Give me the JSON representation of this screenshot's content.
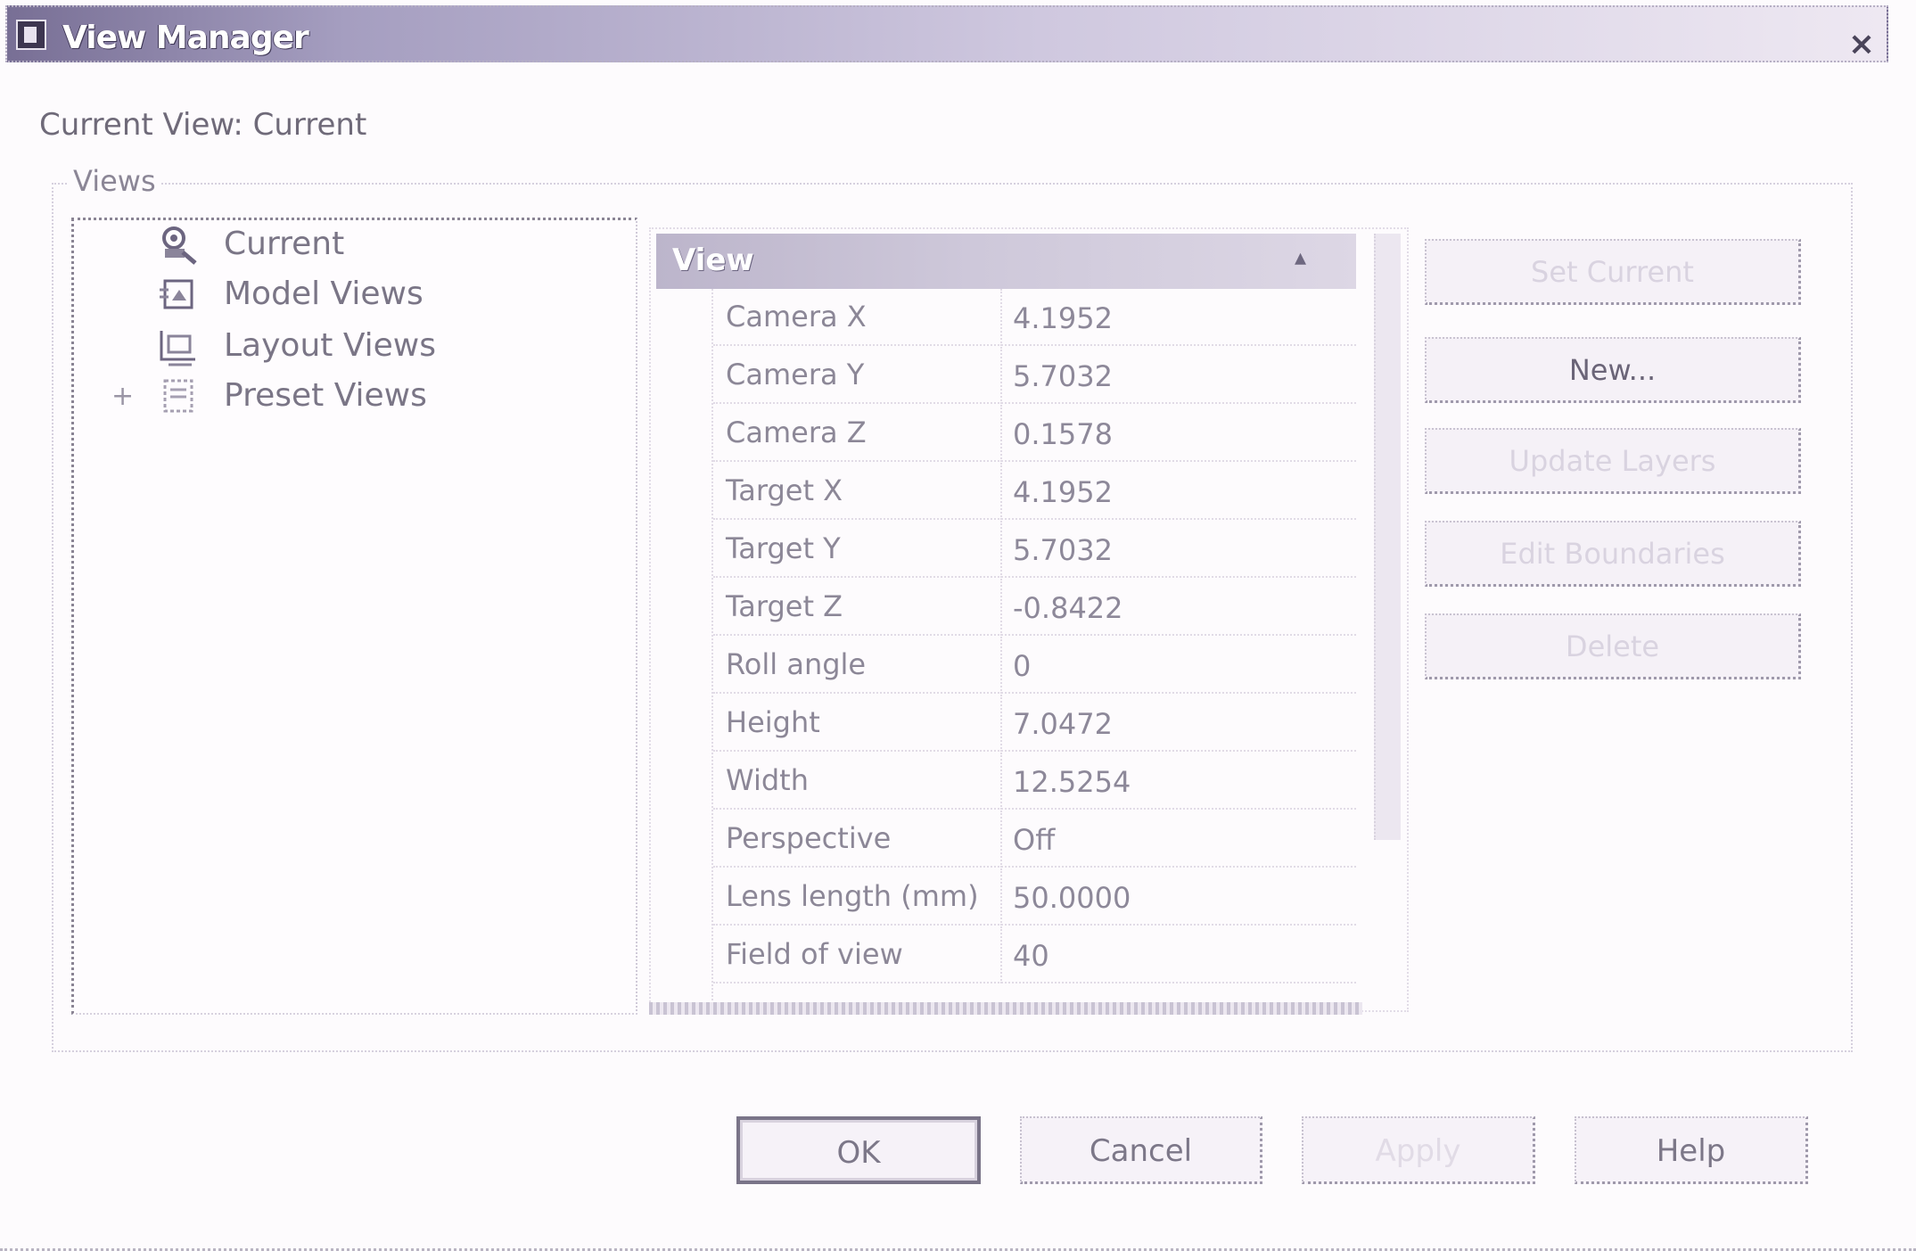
{
  "window": {
    "title": "View Manager",
    "close_glyph": "×"
  },
  "current_view": "Current View: Current",
  "views_group": {
    "label": "Views",
    "tree": [
      {
        "label": "Current",
        "icon": "camera-view-icon",
        "expander": ""
      },
      {
        "label": "Model Views",
        "icon": "model-views-icon",
        "expander": ""
      },
      {
        "label": "Layout Views",
        "icon": "layout-views-icon",
        "expander": ""
      },
      {
        "label": "Preset Views",
        "icon": "preset-views-icon",
        "expander": "+"
      }
    ]
  },
  "properties": {
    "category": "View",
    "collapse_glyph": "▴",
    "rows": [
      {
        "name": "Camera X",
        "value": "4.1952"
      },
      {
        "name": "Camera Y",
        "value": "5.7032"
      },
      {
        "name": "Camera Z",
        "value": "0.1578"
      },
      {
        "name": "Target X",
        "value": "4.1952"
      },
      {
        "name": "Target Y",
        "value": "5.7032"
      },
      {
        "name": "Target Z",
        "value": "-0.8422"
      },
      {
        "name": "Roll angle",
        "value": "0"
      },
      {
        "name": "Height",
        "value": "7.0472"
      },
      {
        "name": "Width",
        "value": "12.5254"
      },
      {
        "name": "Perspective",
        "value": "Off"
      },
      {
        "name": "Lens length (mm)",
        "value": "50.0000"
      },
      {
        "name": "Field of view",
        "value": "40"
      }
    ]
  },
  "side_buttons": {
    "set_current": "Set Current",
    "new": "New...",
    "update_layers": "Update Layers",
    "edit_boundaries": "Edit Boundaries",
    "delete": "Delete"
  },
  "bottom_buttons": {
    "ok": "OK",
    "cancel": "Cancel",
    "apply": "Apply",
    "help": "Help"
  },
  "colors": {
    "titlebar_start": "#786f95",
    "titlebar_end": "#eee8f2",
    "prop_header": "#cec8da"
  }
}
